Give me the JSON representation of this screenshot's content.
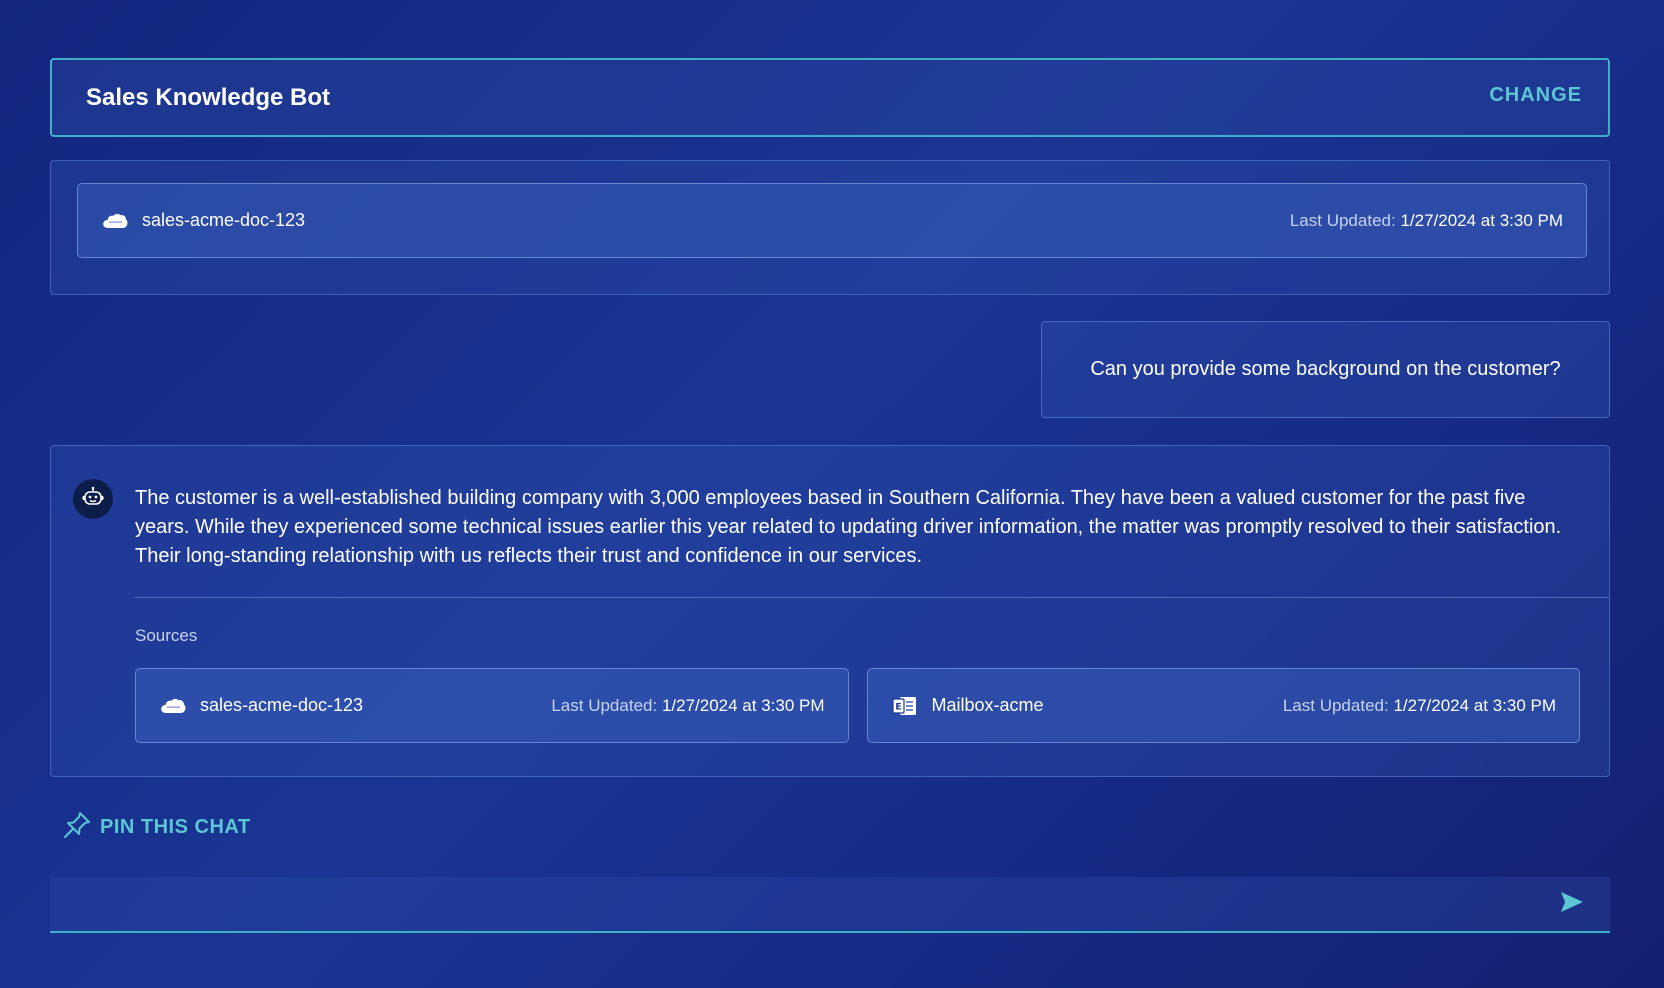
{
  "bot_bar": {
    "name": "Sales Knowledge Bot",
    "change_label": "CHANGE"
  },
  "context": {
    "document": {
      "name": "sales-acme-doc-123",
      "updated_label": "Last Updated:",
      "updated_value": "1/27/2024 at 3:30 PM",
      "icon": "salesforce-cloud-icon"
    }
  },
  "conversation": {
    "user_message": "Can you provide some background on the customer?",
    "bot_message": "The customer is a well-established building company with 3,000 employees based in Southern California. They have been a valued customer for the past five years. While they experienced some technical issues earlier this year related to updating driver information, the matter was promptly resolved to their satisfaction. Their long-standing relationship with us reflects their trust and confidence in our services.",
    "bot_avatar_icon": "robot-icon",
    "sources_label": "Sources",
    "sources": [
      {
        "name": "sales-acme-doc-123",
        "updated_label": "Last Updated:",
        "updated_value": "1/27/2024 at 3:30 PM",
        "icon": "salesforce-cloud-icon"
      },
      {
        "name": "Mailbox-acme",
        "updated_label": "Last Updated:",
        "updated_value": "1/27/2024 at 3:30 PM",
        "icon": "exchange-icon"
      }
    ]
  },
  "pin": {
    "label": "PIN THIS CHAT",
    "icon": "pin-icon"
  },
  "input": {
    "placeholder": "",
    "send_icon": "send-icon"
  },
  "colors": {
    "accent": "#5cc6d4",
    "border_accent": "#3fb0c4",
    "background": "#1a3593"
  }
}
